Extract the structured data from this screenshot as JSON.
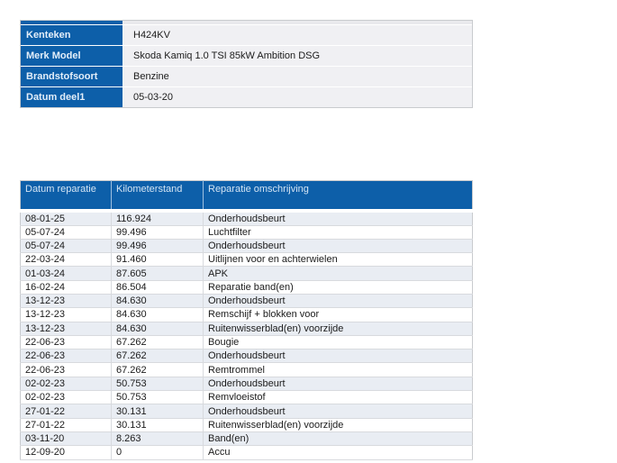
{
  "colors": {
    "accent_blue": "#0d5fa9",
    "header_text": "#d3e4f4",
    "shaded_row": "#e9edf3",
    "value_cell_bg": "#f0f0f3"
  },
  "vehicle_info": {
    "rows": [
      {
        "label": "Kenteken",
        "value": "H424KV"
      },
      {
        "label": "Merk Model",
        "value": "Skoda Kamiq 1.0 TSI 85kW Ambition DSG"
      },
      {
        "label": "Brandstofsoort",
        "value": "Benzine"
      },
      {
        "label": "Datum deel1",
        "value": "05-03-20"
      }
    ]
  },
  "repair_history": {
    "columns": [
      "Datum reparatie",
      "Kilometerstand",
      "Reparatie omschrijving"
    ],
    "rows": [
      [
        "08-01-25",
        "116.924",
        "Onderhoudsbeurt"
      ],
      [
        "05-07-24",
        "99.496",
        "Luchtfilter"
      ],
      [
        "05-07-24",
        "99.496",
        "Onderhoudsbeurt"
      ],
      [
        "22-03-24",
        "91.460",
        "Uitlijnen voor en achterwielen"
      ],
      [
        "01-03-24",
        "87.605",
        "APK"
      ],
      [
        "16-02-24",
        "86.504",
        "Reparatie band(en)"
      ],
      [
        "13-12-23",
        "84.630",
        "Onderhoudsbeurt"
      ],
      [
        "13-12-23",
        "84.630",
        "Remschijf + blokken voor"
      ],
      [
        "13-12-23",
        "84.630",
        "Ruitenwisserblad(en) voorzijde"
      ],
      [
        "22-06-23",
        "67.262",
        "Bougie"
      ],
      [
        "22-06-23",
        "67.262",
        "Onderhoudsbeurt"
      ],
      [
        "22-06-23",
        "67.262",
        "Remtrommel"
      ],
      [
        "02-02-23",
        "50.753",
        "Onderhoudsbeurt"
      ],
      [
        "02-02-23",
        "50.753",
        "Remvloeistof"
      ],
      [
        "27-01-22",
        "30.131",
        "Onderhoudsbeurt"
      ],
      [
        "27-01-22",
        "30.131",
        "Ruitenwisserblad(en) voorzijde"
      ],
      [
        "03-11-20",
        "8.263",
        "Band(en)"
      ],
      [
        "12-09-20",
        "0",
        "Accu"
      ]
    ]
  }
}
